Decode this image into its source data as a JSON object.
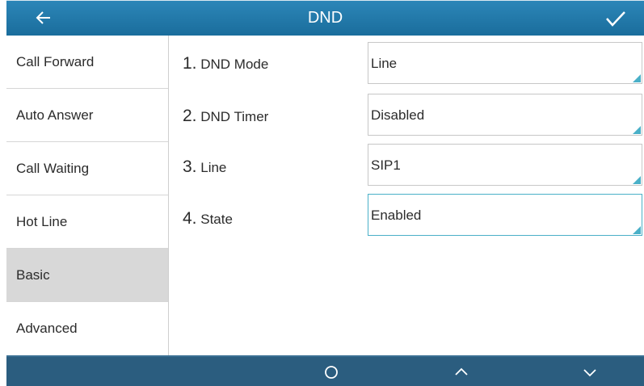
{
  "header": {
    "title": "DND",
    "back_icon": "back-arrow-icon",
    "confirm_icon": "check-icon"
  },
  "sidebar": {
    "items": [
      {
        "label": "Call Forward",
        "active": false
      },
      {
        "label": "Auto Answer",
        "active": false
      },
      {
        "label": "Call Waiting",
        "active": false
      },
      {
        "label": "Hot Line",
        "active": false
      },
      {
        "label": "Basic",
        "active": true
      },
      {
        "label": "Advanced",
        "active": false
      }
    ]
  },
  "settings": {
    "rows": [
      {
        "num": "1.",
        "label": "DND Mode",
        "value": "Line"
      },
      {
        "num": "2.",
        "label": "DND Timer",
        "value": "Disabled"
      },
      {
        "num": "3.",
        "label": "Line",
        "value": "SIP1"
      },
      {
        "num": "4.",
        "label": "State",
        "value": "Enabled"
      }
    ]
  },
  "footer": {
    "icons": [
      "circle-icon",
      "chevron-up-icon",
      "chevron-down-icon"
    ]
  },
  "colors": {
    "header_bg": "#1f78aa",
    "footer_bg": "#2b5d7f",
    "active_item_bg": "#d8d8d8",
    "focus_border": "#4ab0c8",
    "corner_marker": "#4ab0c8"
  }
}
